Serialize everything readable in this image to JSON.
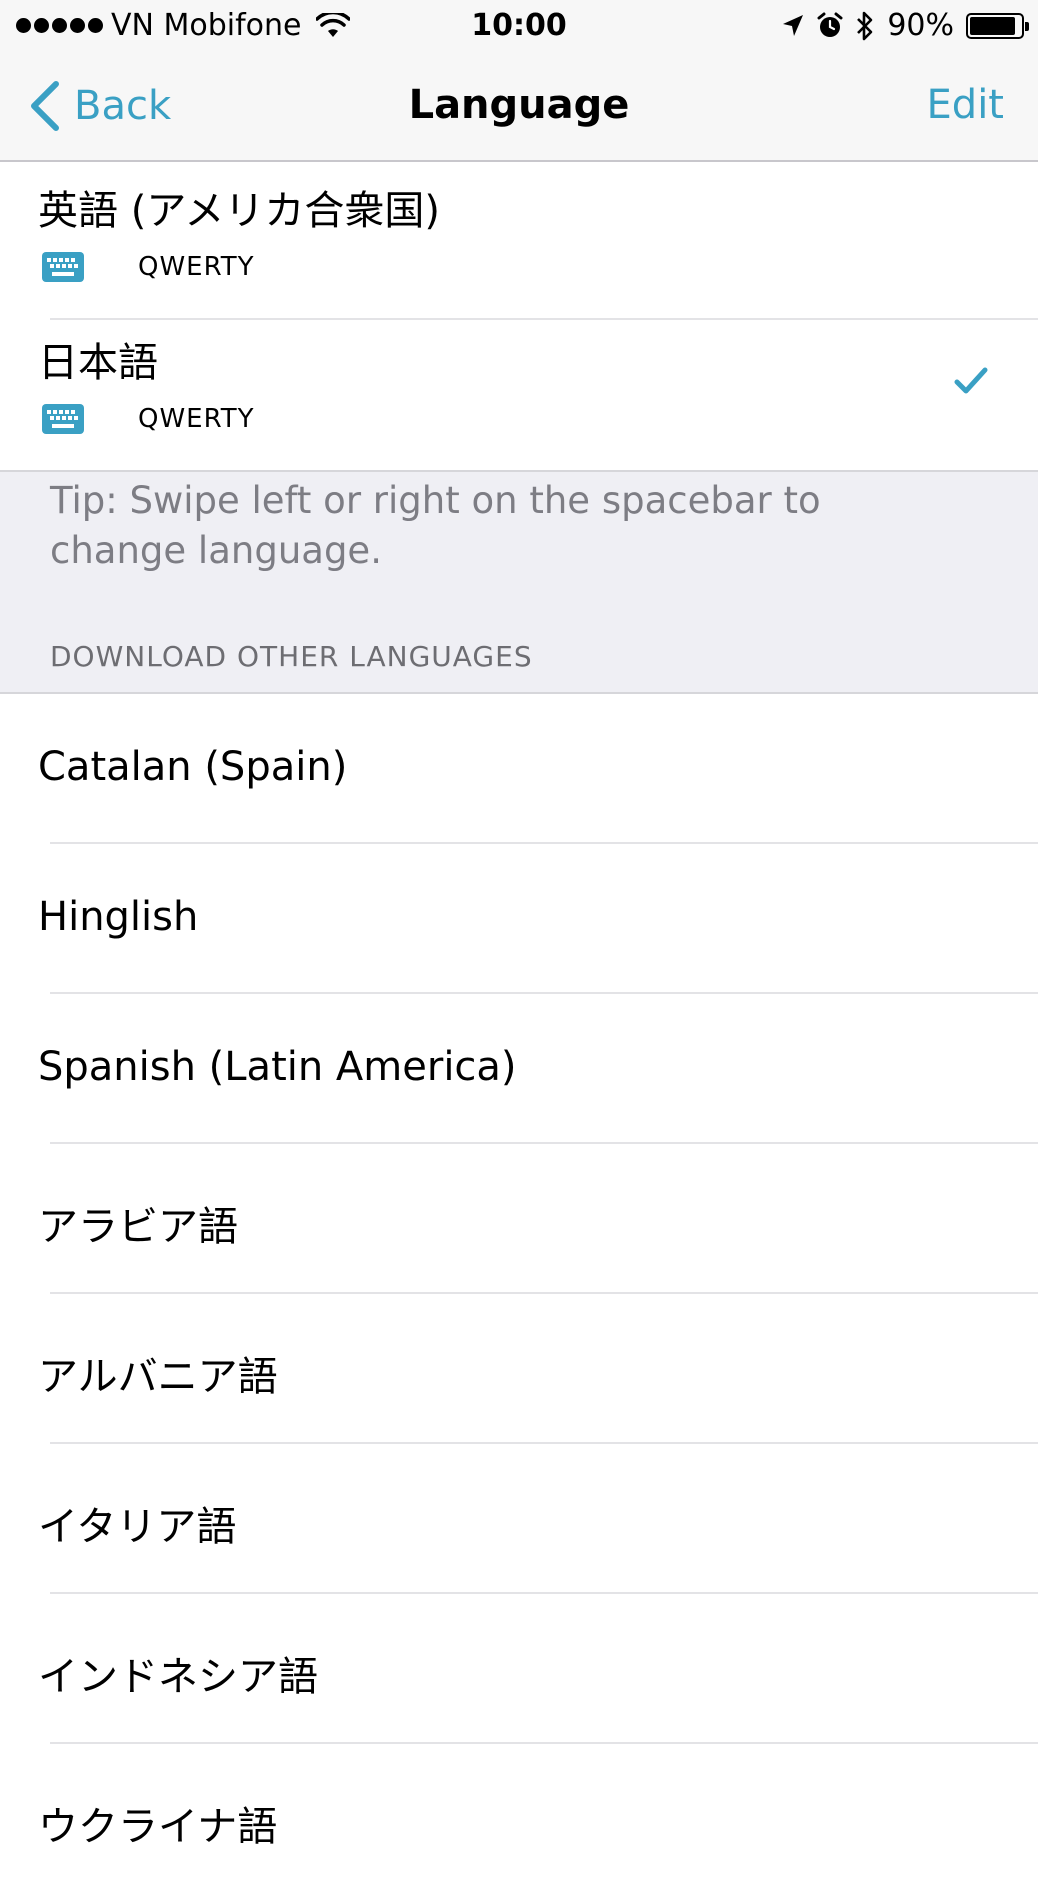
{
  "status_bar": {
    "carrier": "VN Mobifone",
    "time": "10:00",
    "battery": "90%",
    "battery_level": 0.9
  },
  "nav": {
    "back_label": "Back",
    "title": "Language",
    "edit_label": "Edit"
  },
  "enabled_languages": [
    {
      "name": "英語 (アメリカ合衆国)",
      "layout": "QWERTY",
      "selected": false
    },
    {
      "name": "日本語",
      "layout": "QWERTY",
      "selected": true
    }
  ],
  "tip": "Tip: Swipe left or right on the spacebar to change language.",
  "download_section": {
    "header": "DOWNLOAD OTHER LANGUAGES",
    "items": [
      "Catalan (Spain)",
      "Hinglish",
      "Spanish (Latin America)",
      "アラビア語",
      "アルバニア語",
      "イタリア語",
      "インドネシア語",
      "ウクライナ語"
    ]
  },
  "colors": {
    "accent": "#3aa0c4",
    "group_background": "#efeff4",
    "secondary_text": "#7d7d84"
  }
}
